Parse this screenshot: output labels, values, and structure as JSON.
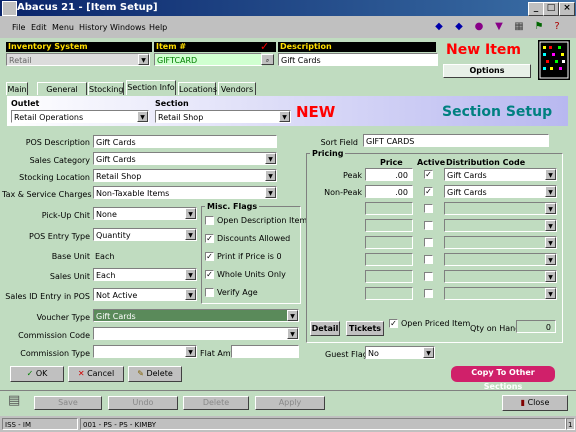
{
  "window": {
    "title": "Abacus 21 - [Item Setup]"
  },
  "menu": [
    "File",
    "Edit",
    "Menu",
    "History",
    "Windows",
    "Help"
  ],
  "header": {
    "inventory_system_label": "Inventory System",
    "inventory_system_value": "Retail",
    "item_label": "Item #",
    "item_value": "GIFTCARD",
    "description_label": "Description",
    "description_value": "Gift Cards",
    "new_item": "New Item",
    "options_button": "Options"
  },
  "tabs": [
    "Main",
    "General Info",
    "Stocking",
    "Section Info",
    "Locations",
    "Vendors"
  ],
  "section_bar": {
    "outlet_label": "Outlet",
    "outlet_value": "Retail Operations",
    "section_label": "Section",
    "section_value": "Retail Shop",
    "new_flag": "NEW",
    "section_setup": "Section Setup"
  },
  "left_fields": {
    "pos_description_label": "POS Description",
    "pos_description_value": "Gift Cards",
    "sales_category_label": "Sales Category",
    "sales_category_value": "Gift Cards",
    "stocking_location_label": "Stocking Location",
    "stocking_location_value": "Retail Shop",
    "tax_label": "Tax & Service Charges",
    "tax_value": "Non-Taxable Items",
    "pickup_chit_label": "Pick-Up Chit",
    "pickup_chit_value": "None",
    "pos_entry_type_label": "POS Entry Type",
    "pos_entry_type_value": "Quantity",
    "base_unit_label": "Base Unit",
    "base_unit_value": "Each",
    "sales_unit_label": "Sales Unit",
    "sales_unit_value": "Each",
    "sales_id_label": "Sales ID Entry in POS",
    "sales_id_value": "Not Active",
    "voucher_type_label": "Voucher Type",
    "voucher_type_value": "Gift Cards",
    "commission_code_label": "Commission Code",
    "commission_code_value": "",
    "commission_type_label": "Commission Type",
    "commission_type_value": "",
    "flat_amt_label": "Flat Amt",
    "flat_amt_value": ""
  },
  "misc_flags": {
    "title": "Misc. Flags",
    "items": [
      {
        "label": "Open Description Item",
        "checked": false
      },
      {
        "label": "Discounts Allowed",
        "checked": true
      },
      {
        "label": "Print if Price is 0",
        "checked": true
      },
      {
        "label": "Whole Units Only",
        "checked": true
      },
      {
        "label": "Verify Age",
        "checked": false
      }
    ]
  },
  "pricing": {
    "sort_field_label": "Sort Field",
    "sort_field_value": "GIFT CARDS",
    "title": "Pricing",
    "col_price": "Price",
    "col_active": "Active",
    "col_dist": "Distribution Code",
    "rows": [
      {
        "label": "Peak",
        "price": ".00",
        "active": true,
        "dist": "Gift Cards"
      },
      {
        "label": "Non-Peak",
        "price": ".00",
        "active": true,
        "dist": "Gift Cards"
      },
      {
        "label": "",
        "price": "",
        "active": false,
        "dist": ""
      },
      {
        "label": "",
        "price": "",
        "active": false,
        "dist": ""
      },
      {
        "label": "",
        "price": "",
        "active": false,
        "dist": ""
      },
      {
        "label": "",
        "price": "",
        "active": false,
        "dist": ""
      },
      {
        "label": "",
        "price": "",
        "active": false,
        "dist": ""
      },
      {
        "label": "",
        "price": "",
        "active": false,
        "dist": ""
      }
    ],
    "detail_button": "Detail",
    "tickets_button": "Tickets",
    "open_priced_label": "Open Priced Item",
    "open_priced_checked": true,
    "qty_on_hand_label": "Qty on Hand",
    "qty_on_hand_value": "0",
    "guest_flag_label": "Guest Flag",
    "guest_flag_value": "No",
    "copy_button": "Copy To Other Sections"
  },
  "actions": {
    "ok": "OK",
    "cancel": "Cancel",
    "delete": "Delete"
  },
  "toolbar_bottom": {
    "save": "Save",
    "undo": "Undo",
    "delete": "Delete",
    "apply": "Apply",
    "close": "Close"
  },
  "status": {
    "cell1": "ISS - IM",
    "cell2": "001 - PS - PS - KIMBY",
    "cell3": "1"
  },
  "colors": {
    "accent_red": "#ff0000",
    "copy_button": "#d0206a",
    "section_setup": "#008080"
  }
}
